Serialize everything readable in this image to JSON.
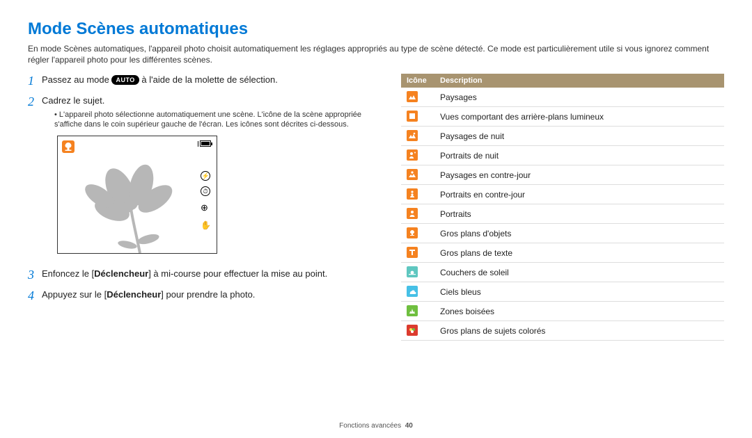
{
  "title": "Mode Scènes automatiques",
  "intro": "En mode Scènes automatiques, l'appareil photo choisit automatiquement les réglages appropriés au type de scène détecté. Ce mode est particulièrement utile si vous ignorez comment régler l'appareil photo pour les différentes scènes.",
  "steps": {
    "n1": "1",
    "s1a": "Passez au mode ",
    "s1_auto": "AUTO",
    "s1b": " à l'aide de la molette de sélection.",
    "n2": "2",
    "s2": "Cadrez le sujet.",
    "s2_bullet": "L'appareil photo sélectionne automatiquement une scène. L'icône de la scène appropriée s'affiche dans le coin supérieur gauche de l'écran. Les icônes sont décrites ci-dessous.",
    "n3": "3",
    "s3a": "Enfoncez le [",
    "s3b": "Déclencheur",
    "s3c": "] à mi-course pour effectuer la mise au point.",
    "n4": "4",
    "s4a": "Appuyez sur le [",
    "s4b": "Déclencheur",
    "s4c": "] pour prendre la photo."
  },
  "table": {
    "h1": "Icône",
    "h2": "Description",
    "rows": [
      {
        "desc": "Paysages",
        "color": "c-orange",
        "icon": "landscape"
      },
      {
        "desc": "Vues comportant des arrière-plans lumineux",
        "color": "c-orange",
        "icon": "white"
      },
      {
        "desc": "Paysages de nuit",
        "color": "c-orange",
        "icon": "night-landscape"
      },
      {
        "desc": "Portraits de nuit",
        "color": "c-orange",
        "icon": "night-portrait"
      },
      {
        "desc": "Paysages en contre-jour",
        "color": "c-orange",
        "icon": "backlight-landscape"
      },
      {
        "desc": "Portraits en contre-jour",
        "color": "c-orange",
        "icon": "backlight-portrait"
      },
      {
        "desc": "Portraits",
        "color": "c-orange",
        "icon": "portrait"
      },
      {
        "desc": "Gros plans d'objets",
        "color": "c-orange",
        "icon": "macro"
      },
      {
        "desc": "Gros plans de texte",
        "color": "c-orange",
        "icon": "text"
      },
      {
        "desc": "Couchers de soleil",
        "color": "c-teal",
        "icon": "sunset"
      },
      {
        "desc": "Ciels bleus",
        "color": "c-sky",
        "icon": "sky"
      },
      {
        "desc": "Zones boisées",
        "color": "c-green",
        "icon": "forest"
      },
      {
        "desc": "Gros plans de sujets colorés",
        "color": "c-red",
        "icon": "color-macro"
      }
    ]
  },
  "footer": {
    "section": "Fonctions avancées",
    "page": "40"
  }
}
